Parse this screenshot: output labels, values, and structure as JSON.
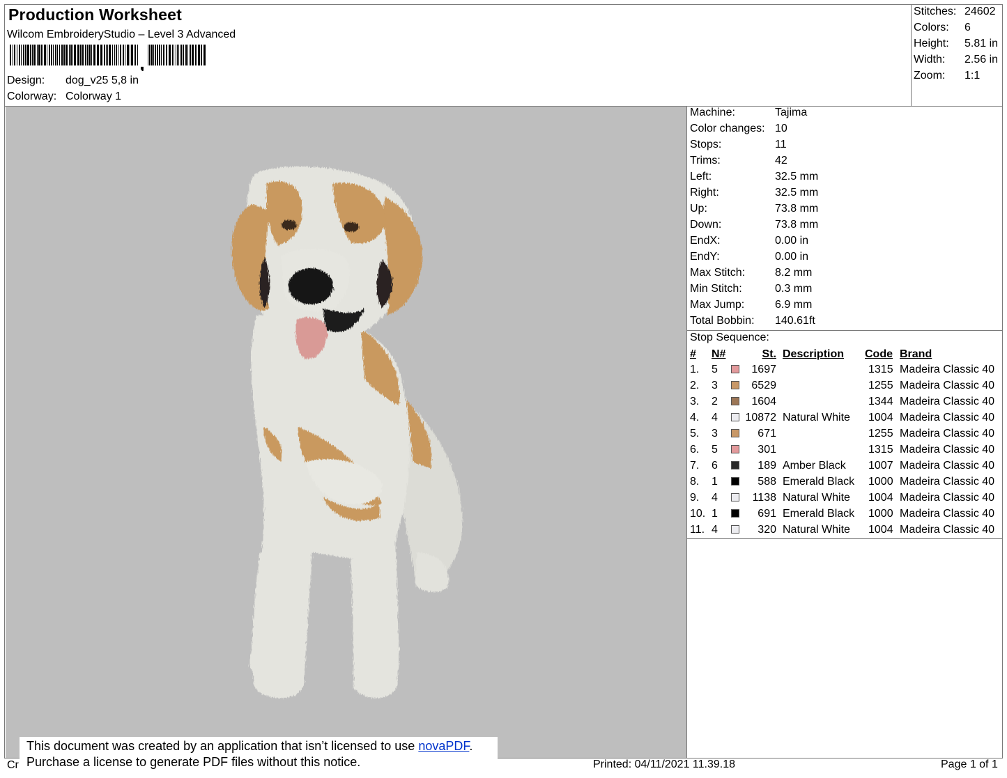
{
  "header": {
    "title": "Production Worksheet",
    "subtitle": "Wilcom EmbroideryStudio – Level 3 Advanced",
    "design_label": "Design:",
    "design_value": "dog_v25 5,8 in",
    "colorway_label": "Colorway:",
    "colorway_value": "Colorway 1"
  },
  "stats": [
    {
      "label": "Stitches:",
      "value": "24602"
    },
    {
      "label": "Colors:",
      "value": "6"
    },
    {
      "label": "Height:",
      "value": "5.81 in"
    },
    {
      "label": "Width:",
      "value": "2.56 in"
    },
    {
      "label": "Zoom:",
      "value": "1:1"
    }
  ],
  "machine_info": [
    {
      "label": "Machine:",
      "value": "Tajima"
    },
    {
      "label": "Color changes:",
      "value": "10"
    },
    {
      "label": "Stops:",
      "value": "11"
    },
    {
      "label": "Trims:",
      "value": "42"
    },
    {
      "label": "Left:",
      "value": "32.5 mm"
    },
    {
      "label": "Right:",
      "value": "32.5 mm"
    },
    {
      "label": "Up:",
      "value": "73.8 mm"
    },
    {
      "label": "Down:",
      "value": "73.8 mm"
    },
    {
      "label": "EndX:",
      "value": "0.00 in"
    },
    {
      "label": "EndY:",
      "value": "0.00 in"
    },
    {
      "label": "Max Stitch:",
      "value": "8.2 mm"
    },
    {
      "label": "Min Stitch:",
      "value": "0.3 mm"
    },
    {
      "label": "Max Jump:",
      "value": "6.9 mm"
    },
    {
      "label": "Total Bobbin:",
      "value": "140.61ft"
    }
  ],
  "stop_sequence": {
    "title": "Stop Sequence:",
    "columns": [
      "#",
      "N#",
      "St.",
      "Description",
      "Code",
      "Brand"
    ],
    "rows": [
      {
        "num": "1.",
        "n": "5",
        "color": "#e39a9c",
        "st": "1697",
        "desc": "",
        "code": "1315",
        "brand": "Madeira Classic 40"
      },
      {
        "num": "2.",
        "n": "3",
        "color": "#c89868",
        "st": "6529",
        "desc": "",
        "code": "1255",
        "brand": "Madeira Classic 40"
      },
      {
        "num": "3.",
        "n": "2",
        "color": "#9c7656",
        "st": "1604",
        "desc": "",
        "code": "1344",
        "brand": "Madeira Classic 40"
      },
      {
        "num": "4.",
        "n": "4",
        "color": "#ececf0",
        "st": "10872",
        "desc": "Natural White",
        "code": "1004",
        "brand": "Madeira Classic 40"
      },
      {
        "num": "5.",
        "n": "3",
        "color": "#c89868",
        "st": "671",
        "desc": "",
        "code": "1255",
        "brand": "Madeira Classic 40"
      },
      {
        "num": "6.",
        "n": "5",
        "color": "#e39a9c",
        "st": "301",
        "desc": "",
        "code": "1315",
        "brand": "Madeira Classic 40"
      },
      {
        "num": "7.",
        "n": "6",
        "color": "#2a2a2a",
        "st": "189",
        "desc": "Amber Black",
        "code": "1007",
        "brand": "Madeira Classic 40"
      },
      {
        "num": "8.",
        "n": "1",
        "color": "#000000",
        "st": "588",
        "desc": "Emerald Black",
        "code": "1000",
        "brand": "Madeira Classic 40"
      },
      {
        "num": "9.",
        "n": "4",
        "color": "#ececf0",
        "st": "1138",
        "desc": "Natural White",
        "code": "1004",
        "brand": "Madeira Classic 40"
      },
      {
        "num": "10.",
        "n": "1",
        "color": "#000000",
        "st": "691",
        "desc": "Emerald Black",
        "code": "1000",
        "brand": "Madeira Classic 40"
      },
      {
        "num": "11.",
        "n": "4",
        "color": "#ececf0",
        "st": "320",
        "desc": "Natural White",
        "code": "1004",
        "brand": "Madeira Classic 40"
      }
    ]
  },
  "footer": {
    "notice_line1": "This document was created by an application that isn’t licensed to use ",
    "notice_link": "novaPDF",
    "notice_line1_end": ".",
    "notice_line2": "Purchase a license to generate PDF files without this notice.",
    "cr_fragment": "Cr",
    "printed": "Printed: 04/11/2021 11.39.18",
    "page": "Page 1 of 1"
  }
}
